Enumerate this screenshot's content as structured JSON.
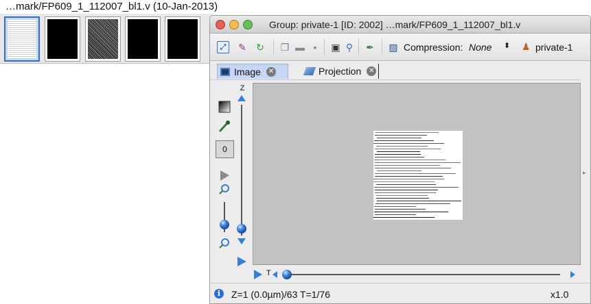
{
  "gallery": {
    "title": "…mark/FP609_1_112007_bl1.v (10-Jan-2013)",
    "thumbnails": [
      "thumb-1",
      "thumb-2",
      "thumb-3",
      "thumb-4",
      "thumb-5"
    ]
  },
  "window": {
    "title": "Group: private-1 [ID: 2002] …mark/FP609_1_112007_bl1.v"
  },
  "toolbar": {
    "compression_label": "Compression:",
    "compression_value": "None",
    "user": "private-1"
  },
  "tabs": [
    {
      "label": "Image",
      "icon": "image-icon",
      "active": true
    },
    {
      "label": "Projection",
      "icon": "projection-icon",
      "active": false
    }
  ],
  "sidebar": {
    "channel_value": "0",
    "z_label": "Z",
    "t_label": "T"
  },
  "status": {
    "text": "Z=1 (0.0µm)/63 T=1/76",
    "zoom": "x1.0"
  },
  "colors": {
    "accent": "#3b6db4",
    "slider_thumb": "#3a7fd6",
    "tab_active": "#c7d6f4"
  }
}
